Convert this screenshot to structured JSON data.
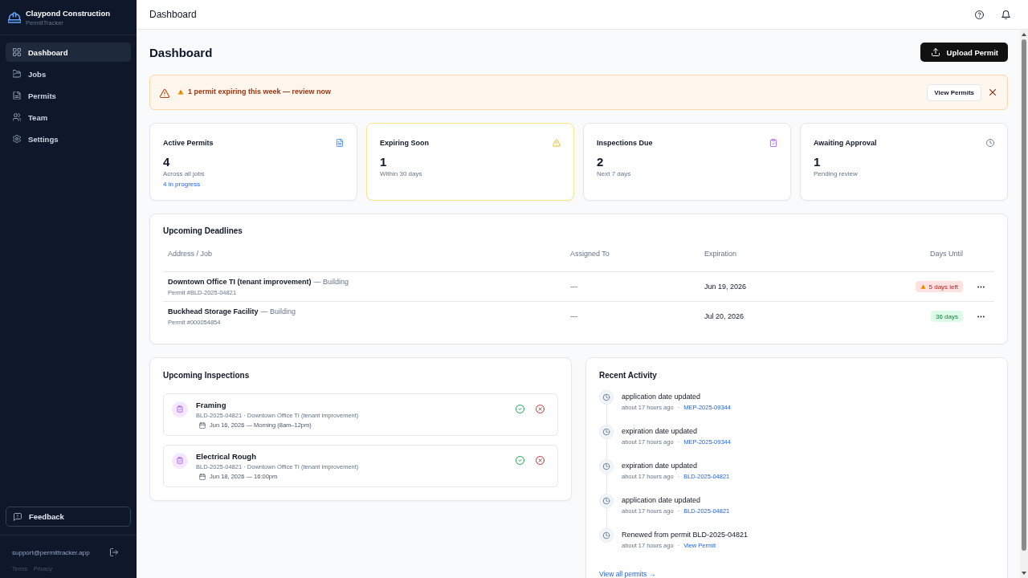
{
  "sidebar": {
    "brand": {
      "name": "Claypond Construction",
      "product": "PermitTracker"
    },
    "nav": [
      {
        "label": "Dashboard",
        "selected": true
      },
      {
        "label": "Jobs",
        "selected": false
      },
      {
        "label": "Permits",
        "selected": false
      },
      {
        "label": "Team",
        "selected": false
      },
      {
        "label": "Settings",
        "selected": false
      }
    ],
    "feedback": "Feedback",
    "account_email": "support@permittracker.app",
    "footer_links": [
      "Terms",
      "Privacy"
    ]
  },
  "header": {
    "title": "Dashboard"
  },
  "page": {
    "title": "Dashboard",
    "upload_button": "Upload Permit"
  },
  "alert": {
    "message": "1 permit expiring this week — review now",
    "action": "View Permits"
  },
  "stats": [
    {
      "label": "Active Permits",
      "value": "4",
      "caption": "Across all jobs",
      "note": "4 in progress",
      "highlighted": false
    },
    {
      "label": "Expiring Soon",
      "value": "1",
      "caption": "Within 30 days",
      "highlighted": true
    },
    {
      "label": "Inspections Due",
      "value": "2",
      "caption": "Next 7 days",
      "highlighted": false
    },
    {
      "label": "Awaiting Approval",
      "value": "1",
      "caption": "Pending review",
      "highlighted": false
    }
  ],
  "deadlines": {
    "title": "Upcoming Deadlines",
    "columns": [
      "Address / Job",
      "Assigned To",
      "Expiration",
      "Days Until"
    ],
    "rows": [
      {
        "job": "Downtown Office TI (tenant improvement)",
        "type": "— Building",
        "permit": "Permit #BLD-2025-04821",
        "assigned_to": "—",
        "expiration": "Jun 19, 2026",
        "days_until": {
          "text": "5 days left",
          "kind": "warning"
        }
      },
      {
        "job": "Buckhead Storage Facility",
        "type": "— Building",
        "permit": "Permit #000054854",
        "assigned_to": "—",
        "expiration": "Jul 20, 2026",
        "days_until": {
          "text": "36 days",
          "kind": "ok"
        }
      }
    ]
  },
  "inspections": {
    "title": "Upcoming Inspections",
    "items": [
      {
        "title": "Framing",
        "details": "BLD-2025-04821 · Downtown Office TI (tenant improvement)",
        "schedule": "Jun 16, 2026 — Morning (8am–12pm)"
      },
      {
        "title": "Electrical Rough",
        "details": "BLD-2025-04821 · Downtown Office TI (tenant improvement)",
        "schedule": "Jun 18, 2026 — 16:00pm"
      }
    ]
  },
  "activity": {
    "title": "Recent Activity",
    "items": [
      {
        "text": "application date updated",
        "time": "about 17 hours ago",
        "separator": "·",
        "link": "MEP-2025-09344"
      },
      {
        "text": "expiration date updated",
        "time": "about 17 hours ago",
        "separator": "·",
        "link": "MEP-2025-09344"
      },
      {
        "text": "expiration date updated",
        "time": "about 17 hours ago",
        "separator": "·",
        "link": "BLD-2025-04821"
      },
      {
        "text": "application date updated",
        "time": "about 17 hours ago",
        "separator": "·",
        "link": "BLD-2025-04821"
      },
      {
        "text": "Renewed from permit BLD-2025-04821",
        "time": "about 17 hours ago",
        "separator": "·",
        "link": "View Permit"
      }
    ],
    "footer_link": "View all permits →"
  }
}
